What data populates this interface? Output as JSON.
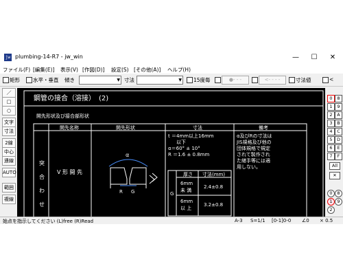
{
  "window": {
    "title": "plumbing-14-R7 - jw_win",
    "icon_label": "jw",
    "minimize": "—",
    "maximize": "☐",
    "close": "✕"
  },
  "menu": [
    "ファイル(F)",
    "[編集(E)]",
    "表示(V)",
    "[作図(D)]",
    "設定(S)",
    "[その他(A)]",
    "ヘルプ(H)"
  ],
  "toolbar": {
    "rect_label": "矩形",
    "hv_label": "水平・垂直",
    "slope_label": "傾き",
    "dim_label": "寸法",
    "every15_label": "15度毎",
    "arc_btn": "●- - -",
    "arrow_btn": "<- - - -",
    "dimval_label": "寸法値",
    "lt_label": "<"
  },
  "left_tools": [
    "／",
    "□",
    "○",
    "文字",
    "寸法",
    "2線",
    "中心線",
    "連線",
    "AUTO",
    "範囲",
    "複線"
  ],
  "right_tools": {
    "rows": [
      [
        "0",
        "8"
      ],
      [
        "1",
        "9"
      ],
      [
        "2",
        "A"
      ],
      [
        "3",
        "B"
      ],
      [
        "4",
        "C"
      ],
      [
        "5",
        "D"
      ],
      [
        "6",
        "E"
      ],
      [
        "7",
        "F"
      ]
    ],
    "all": "All",
    "x": "✕",
    "bottom": [
      [
        "0",
        "8"
      ],
      [
        "1",
        "9"
      ],
      [
        "2",
        ""
      ]
    ]
  },
  "drawing": {
    "title": "鋼管の接合（溶接）　(2)",
    "subtitle": "開先形状及び接合部形状",
    "headers": [
      "開先名称",
      "開先形状",
      "寸法",
      "備考"
    ],
    "side_label": [
      "突",
      "合",
      "わ",
      "せ"
    ],
    "groove_name": "V 形 開 先",
    "dims_text": [
      "t ＝4mm以上16mm",
      "以下",
      "α＝60° ± 10°",
      "R ＝1.6 ± 0.8mm"
    ],
    "note": [
      "α及びRの寸法は",
      "JIS規格及び他の",
      "団体規格で規定",
      "されて製作され",
      "た継手等には適",
      "用しない。"
    ],
    "alpha": "α",
    "r_label": "R",
    "g_label": "G",
    "subtable": {
      "col1": "厚さ",
      "col2": "寸法(mm)",
      "g_row": "G",
      "row1_th": [
        "6mm",
        "未 満"
      ],
      "row1_val": "2.4±0.8",
      "row2_th": [
        "6mm",
        "以 上"
      ],
      "row2_val": "3.2±0.8"
    }
  },
  "status": {
    "prompt": "始点を指示してください (L)free (R)Read",
    "paper": "A-3",
    "scale": "S=1/1",
    "layer": "[0-1]0-0",
    "angle": "∠0",
    "zoom": "× 0.5"
  }
}
